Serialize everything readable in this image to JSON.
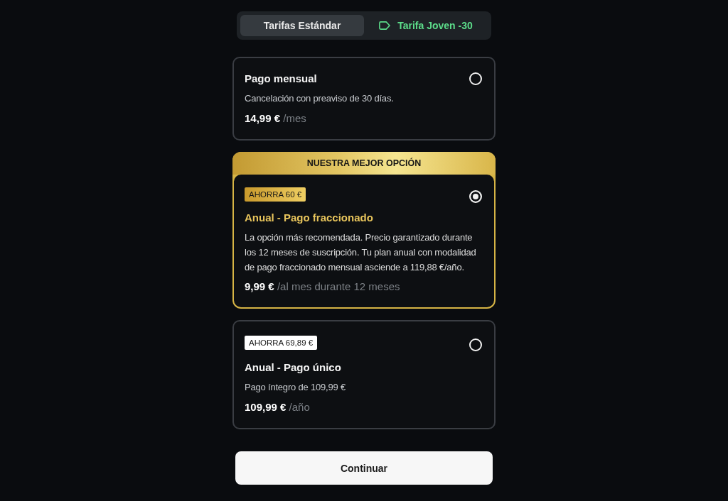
{
  "tabs": [
    {
      "label": "Tarifas Estándar",
      "kind": "plain",
      "selected": true
    },
    {
      "label": "Tarifa Joven -30",
      "kind": "promo",
      "selected": false
    }
  ],
  "plans": [
    {
      "kind": "standard",
      "title": "Pago mensual",
      "description": "Cancelación con preaviso de 30 días.",
      "price": "14,99 €",
      "period": "/mes",
      "selected": false
    },
    {
      "kind": "featured",
      "banner": "NUESTRA MEJOR OPCIÓN",
      "badge": "AHORRA 60 €",
      "title": "Anual - Pago fraccionado",
      "description": "La opción más recomendada. Precio garantizado durante los 12 meses de suscripción. Tu plan anual con modalidad de pago fraccionado mensual asciende a 119,88 €/año.",
      "price": "9,99 €",
      "period": "/al mes durante 12 meses",
      "selected": true
    },
    {
      "kind": "standard",
      "badge": "AHORRA 69,89 €",
      "title": "Anual - Pago único",
      "description": "Pago íntegro de 109,99 €",
      "price": "109,99 €",
      "period": "/año",
      "selected": false
    }
  ],
  "button": {
    "label": "Continuar"
  }
}
